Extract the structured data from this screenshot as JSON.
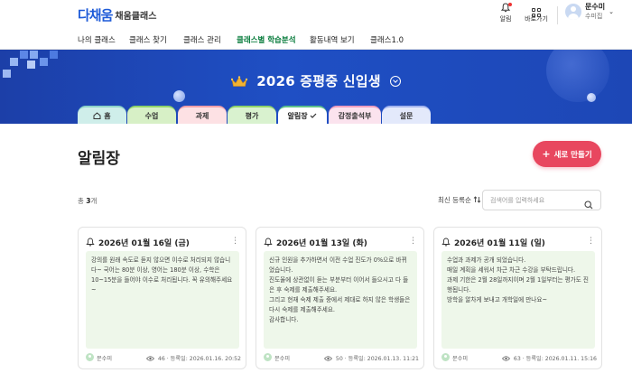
{
  "header": {
    "logo_mark": "다채움",
    "logo_text": "채움클래스",
    "actions": [
      {
        "label": "알림",
        "icon": "bell-icon"
      },
      {
        "label": "바로가기",
        "icon": "grid-icon"
      }
    ],
    "user": {
      "name": "문수미",
      "role": "수미집"
    }
  },
  "nav": {
    "items": [
      {
        "label": "나의 클래스"
      },
      {
        "label": "클래스 찾기"
      },
      {
        "label": "클래스 관리"
      },
      {
        "label": "클래스별 학습분석",
        "active": true
      },
      {
        "label": "활동내역 보기"
      },
      {
        "label": "클래스1.0"
      }
    ]
  },
  "banner": {
    "title": "2026 증평중 신입생",
    "bg_color": "#1f4fc4"
  },
  "tabs": [
    {
      "label": "홈",
      "icon": "home-icon",
      "color": "#cfeeea"
    },
    {
      "label": "수업",
      "color": "#d7f0c6"
    },
    {
      "label": "과제",
      "color": "#fde1e4"
    },
    {
      "label": "평가",
      "color": "#d9f2cf"
    },
    {
      "label": "알림장",
      "active": true,
      "color": "#ffffff"
    },
    {
      "label": "감정출석부",
      "color": "#fbe3ee"
    },
    {
      "label": "설문",
      "color": "#e3e9fb"
    }
  ],
  "main": {
    "title": "알림장",
    "new_button": "새로 만들기",
    "count_prefix": "총",
    "count_value": "3",
    "count_suffix": "개",
    "sort_label": "최신 등록순",
    "search_placeholder": "검색어를 입력하세요"
  },
  "cards": [
    {
      "date": "2026년 01월 16일 (금)",
      "lines": [
        "강의를 원래 속도로 듣지 않으면 이수로 처리되지 않습니다~ 국어는 80분 이상, 영어는 180분 이상, 수학은 10~15분을 들어야 이수로 처리됩니다. 꼭 유의해주세요~"
      ],
      "author": "문수미",
      "views": "46",
      "registered": "등록일: 2026.01.16. 20:52"
    },
    {
      "date": "2026년 01월 13일 (화)",
      "lines": [
        "신규 인원을 추가하면서 이전 수업 진도가 0%으로 바뀌었습니다.",
        "진도율에 상관없이 듣는 부분부터 이어서 들으시고 다 들은 후 숙제를 제출해주세요.",
        "그리고 현재 숙제 제출 중에서 제대로 하지 않은 학생들은 다시 숙제를 제출해주세요.",
        "감사합니다."
      ],
      "author": "문수미",
      "views": "50",
      "registered": "등록일: 2026.01.13. 11:21"
    },
    {
      "date": "2026년 01월 11일 (일)",
      "lines": [
        "수업과 과제가 공개 되었습니다.",
        "매일 계획을 세워서 차근 차근 수강을 부탁드립니다.",
        "과제 기한은 2월 28일까지이며 2월 1일부터는 평가도 진행됩니다.",
        "방학을 알차게 보내고 개학일에 만나요~"
      ],
      "author": "문수미",
      "views": "63",
      "registered": "등록일: 2026.01.11. 15:16"
    }
  ],
  "colors": {
    "accent_green": "#0a7d3e",
    "new_button": "#e8475f",
    "card_body": "#eef7ea"
  }
}
